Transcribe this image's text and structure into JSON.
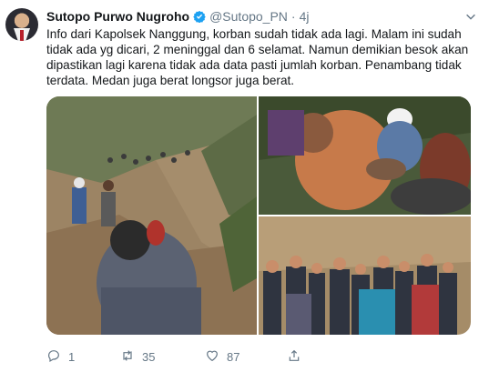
{
  "tweet": {
    "author": {
      "display_name": "Sutopo Purwo Nugroho",
      "handle": "@Sutopo_PN",
      "separator": "·",
      "time": "4j",
      "verified": true
    },
    "text": "Info dari Kapolsek Nanggung, korban sudah tidak ada lagi. Malam ini sudah\ntidak ada yg dicari, 2 meninggal dan 6 selamat. Namun demikian besok akan\ndipastikan lagi karena tidak ada data pasti jumlah korban. Penambang tidak\nterdata. Medan juga berat longsor juga berat.",
    "actions": {
      "reply_count": "1",
      "retweet_count": "35",
      "like_count": "87"
    },
    "icons": {
      "verified": "verified-badge-icon",
      "menu": "chevron-down-icon",
      "reply": "reply-icon",
      "retweet": "retweet-icon",
      "like": "heart-icon",
      "share": "share-icon"
    },
    "colors": {
      "accent": "#1da1f2",
      "muted": "#657786",
      "text": "#14171a"
    }
  }
}
